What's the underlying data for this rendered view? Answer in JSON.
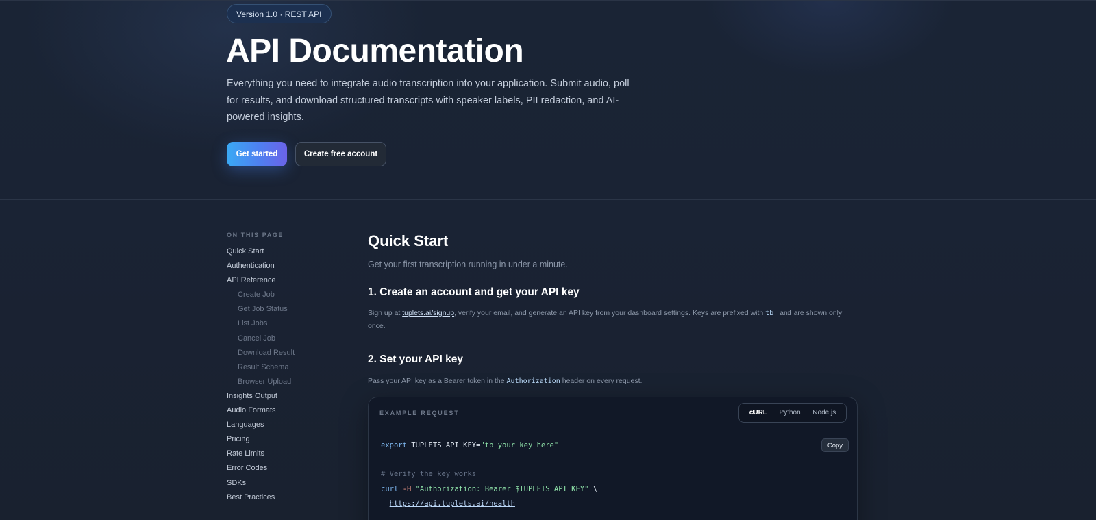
{
  "hero": {
    "badge": "Version 1.0 · REST API",
    "title": "API Documentation",
    "description": "Everything you need to integrate audio transcription into your application. Submit audio, poll for results, and download structured transcripts with speaker labels, PII redaction, and AI-powered insights.",
    "primary_button": "Get started",
    "secondary_button": "Create free account",
    "colors": {
      "accent_start": "#3aa9f4",
      "accent_end": "#6b63e8",
      "background": "#1a2334"
    }
  },
  "toc": {
    "heading": "ON THIS PAGE",
    "items": [
      {
        "label": "Quick Start"
      },
      {
        "label": "Authentication"
      },
      {
        "label": "API Reference"
      },
      {
        "label": "Create Job"
      },
      {
        "label": "Get Job Status"
      },
      {
        "label": "List Jobs"
      },
      {
        "label": "Cancel Job"
      },
      {
        "label": "Download Result"
      },
      {
        "label": "Result Schema"
      },
      {
        "label": "Browser Upload"
      },
      {
        "label": "Insights Output"
      },
      {
        "label": "Audio Formats"
      },
      {
        "label": "Languages"
      },
      {
        "label": "Pricing"
      },
      {
        "label": "Rate Limits"
      },
      {
        "label": "Error Codes"
      },
      {
        "label": "SDKs"
      },
      {
        "label": "Best Practices"
      }
    ]
  },
  "main": {
    "title": "Quick Start",
    "subtitle": "Get your first transcription running in under a minute.",
    "step1": {
      "title": "1. Create an account and get your API key",
      "text_before_link": "Sign up at ",
      "link": "tuplets.ai/signup",
      "text_after_link": ", verify your email, and generate an API key from your dashboard settings. Keys are prefixed with ",
      "code": "tb_",
      "text_end": " and are shown only once."
    },
    "step2": {
      "title": "2. Set your API key",
      "text_before_code": "Pass your API key as a Bearer token in the ",
      "code": "Authorization",
      "text_after_code": " header on every request."
    },
    "code_example": {
      "label": "EXAMPLE REQUEST",
      "tabs": [
        "cURL",
        "Python",
        "Node.js"
      ],
      "active_tab": "cURL",
      "copy_label": "Copy",
      "line1_keyword": "export",
      "line1_var": " TUPLETS_API_KEY=",
      "line1_value": "\"tb_your_key_here\"",
      "comment": "# Verify the key works",
      "curl_cmd": "curl",
      "curl_flag": " -H",
      "curl_header": " \"Authorization: Bearer $TUPLETS_API_KEY\"",
      "curl_continue": " \\",
      "url": "https://api.tuplets.ai/health"
    }
  }
}
